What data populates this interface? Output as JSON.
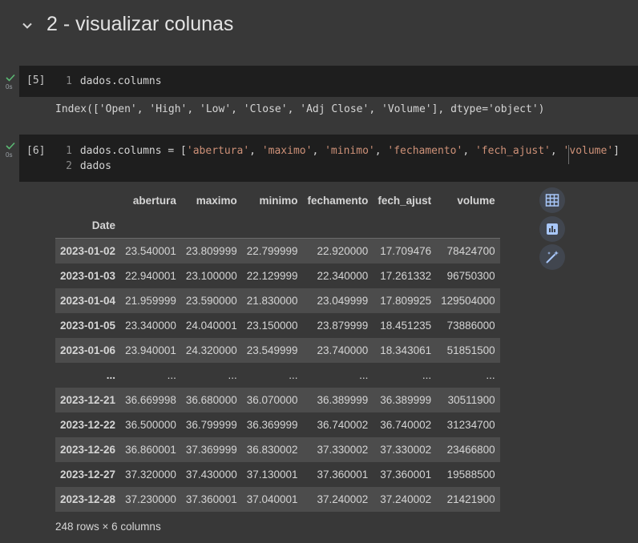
{
  "section": {
    "title": "2 - visualizar colunas"
  },
  "cell1": {
    "status": "0s",
    "exec_count": "[5]",
    "line_number": "1",
    "code": "dados.columns",
    "output": "Index(['Open', 'High', 'Low', 'Close', 'Adj Close', 'Volume'], dtype='object')"
  },
  "cell2": {
    "status": "0s",
    "exec_count": "[6]",
    "line1_number": "1",
    "line1_prefix": "dados.columns = [",
    "line1_str1": "'abertura'",
    "line1_str2": "'maximo'",
    "line1_str3": "'minimo'",
    "line1_str4": "'fechamento'",
    "line1_str5": "'fech_ajust'",
    "line1_str6": "'volume'",
    "line1_sep": ", ",
    "line1_suffix": "]",
    "line2_number": "2",
    "line2_code": "dados"
  },
  "dataframe": {
    "columns": [
      "abertura",
      "maximo",
      "minimo",
      "fechamento",
      "fech_ajust",
      "volume"
    ],
    "index_name": "Date",
    "rows": [
      {
        "date": "2023-01-02",
        "values": [
          "23.540001",
          "23.809999",
          "22.799999",
          "22.920000",
          "17.709476",
          "78424700"
        ]
      },
      {
        "date": "2023-01-03",
        "values": [
          "22.940001",
          "23.100000",
          "22.129999",
          "22.340000",
          "17.261332",
          "96750300"
        ]
      },
      {
        "date": "2023-01-04",
        "values": [
          "21.959999",
          "23.590000",
          "21.830000",
          "23.049999",
          "17.809925",
          "129504000"
        ]
      },
      {
        "date": "2023-01-05",
        "values": [
          "23.340000",
          "24.040001",
          "23.150000",
          "23.879999",
          "18.451235",
          "73886000"
        ]
      },
      {
        "date": "2023-01-06",
        "values": [
          "23.940001",
          "24.320000",
          "23.549999",
          "23.740000",
          "18.343061",
          "51851500"
        ]
      },
      {
        "date": "...",
        "values": [
          "...",
          "...",
          "...",
          "...",
          "...",
          "..."
        ]
      },
      {
        "date": "2023-12-21",
        "values": [
          "36.669998",
          "36.680000",
          "36.070000",
          "36.389999",
          "36.389999",
          "30511900"
        ]
      },
      {
        "date": "2023-12-22",
        "values": [
          "36.500000",
          "36.799999",
          "36.369999",
          "36.740002",
          "36.740002",
          "31234700"
        ]
      },
      {
        "date": "2023-12-26",
        "values": [
          "36.860001",
          "37.369999",
          "36.830002",
          "37.330002",
          "37.330002",
          "23466800"
        ]
      },
      {
        "date": "2023-12-27",
        "values": [
          "37.320000",
          "37.430000",
          "37.130001",
          "37.360001",
          "37.360001",
          "19588500"
        ]
      },
      {
        "date": "2023-12-28",
        "values": [
          "37.230000",
          "37.360001",
          "37.040001",
          "37.240002",
          "37.240002",
          "21421900"
        ]
      }
    ],
    "footer": "248 rows × 6 columns"
  },
  "icons": [
    "chevron-down-icon",
    "check-icon",
    "table-icon",
    "chart-icon",
    "magic-wand-icon"
  ],
  "colors": {
    "background": "#383838",
    "code_bg": "#1e1e1e",
    "string": "#ce9178",
    "check": "#5bb974",
    "row_stripe": "#4c4c4c",
    "button_bg": "#41464f",
    "button_icon": "#a8c7fa"
  }
}
